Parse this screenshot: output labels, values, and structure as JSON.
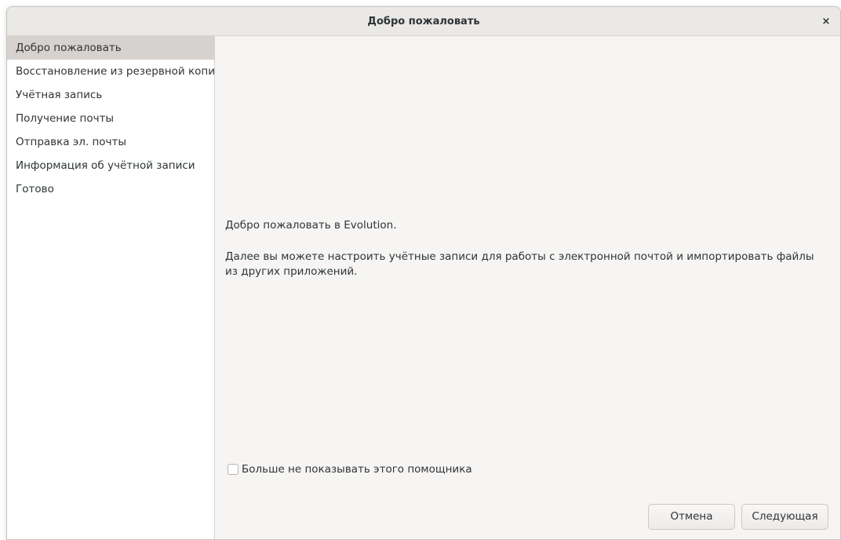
{
  "window": {
    "title": "Добро пожаловать",
    "close_label": "×"
  },
  "sidebar": {
    "items": [
      {
        "label": "Добро пожаловать",
        "active": true
      },
      {
        "label": "Восстановление из резервной копии",
        "active": false
      },
      {
        "label": "Учётная запись",
        "active": false
      },
      {
        "label": "Получение почты",
        "active": false
      },
      {
        "label": "Отправка эл. почты",
        "active": false
      },
      {
        "label": "Информация об учётной записи",
        "active": false
      },
      {
        "label": "Готово",
        "active": false
      }
    ]
  },
  "content": {
    "welcome_text": "Добро пожаловать в Evolution.",
    "description": "Далее вы можете настроить учётные записи для работы с электронной почтой и импортировать файлы из других приложений.",
    "checkbox_label": "Больше не показывать этого помощника",
    "checkbox_checked": false
  },
  "buttons": {
    "cancel_label": "Отмена",
    "next_label": "Следующая"
  },
  "colors": {
    "accent_selected": "#d6d2cf",
    "window_bg": "#f6f5f4",
    "text": "#2e3436"
  }
}
